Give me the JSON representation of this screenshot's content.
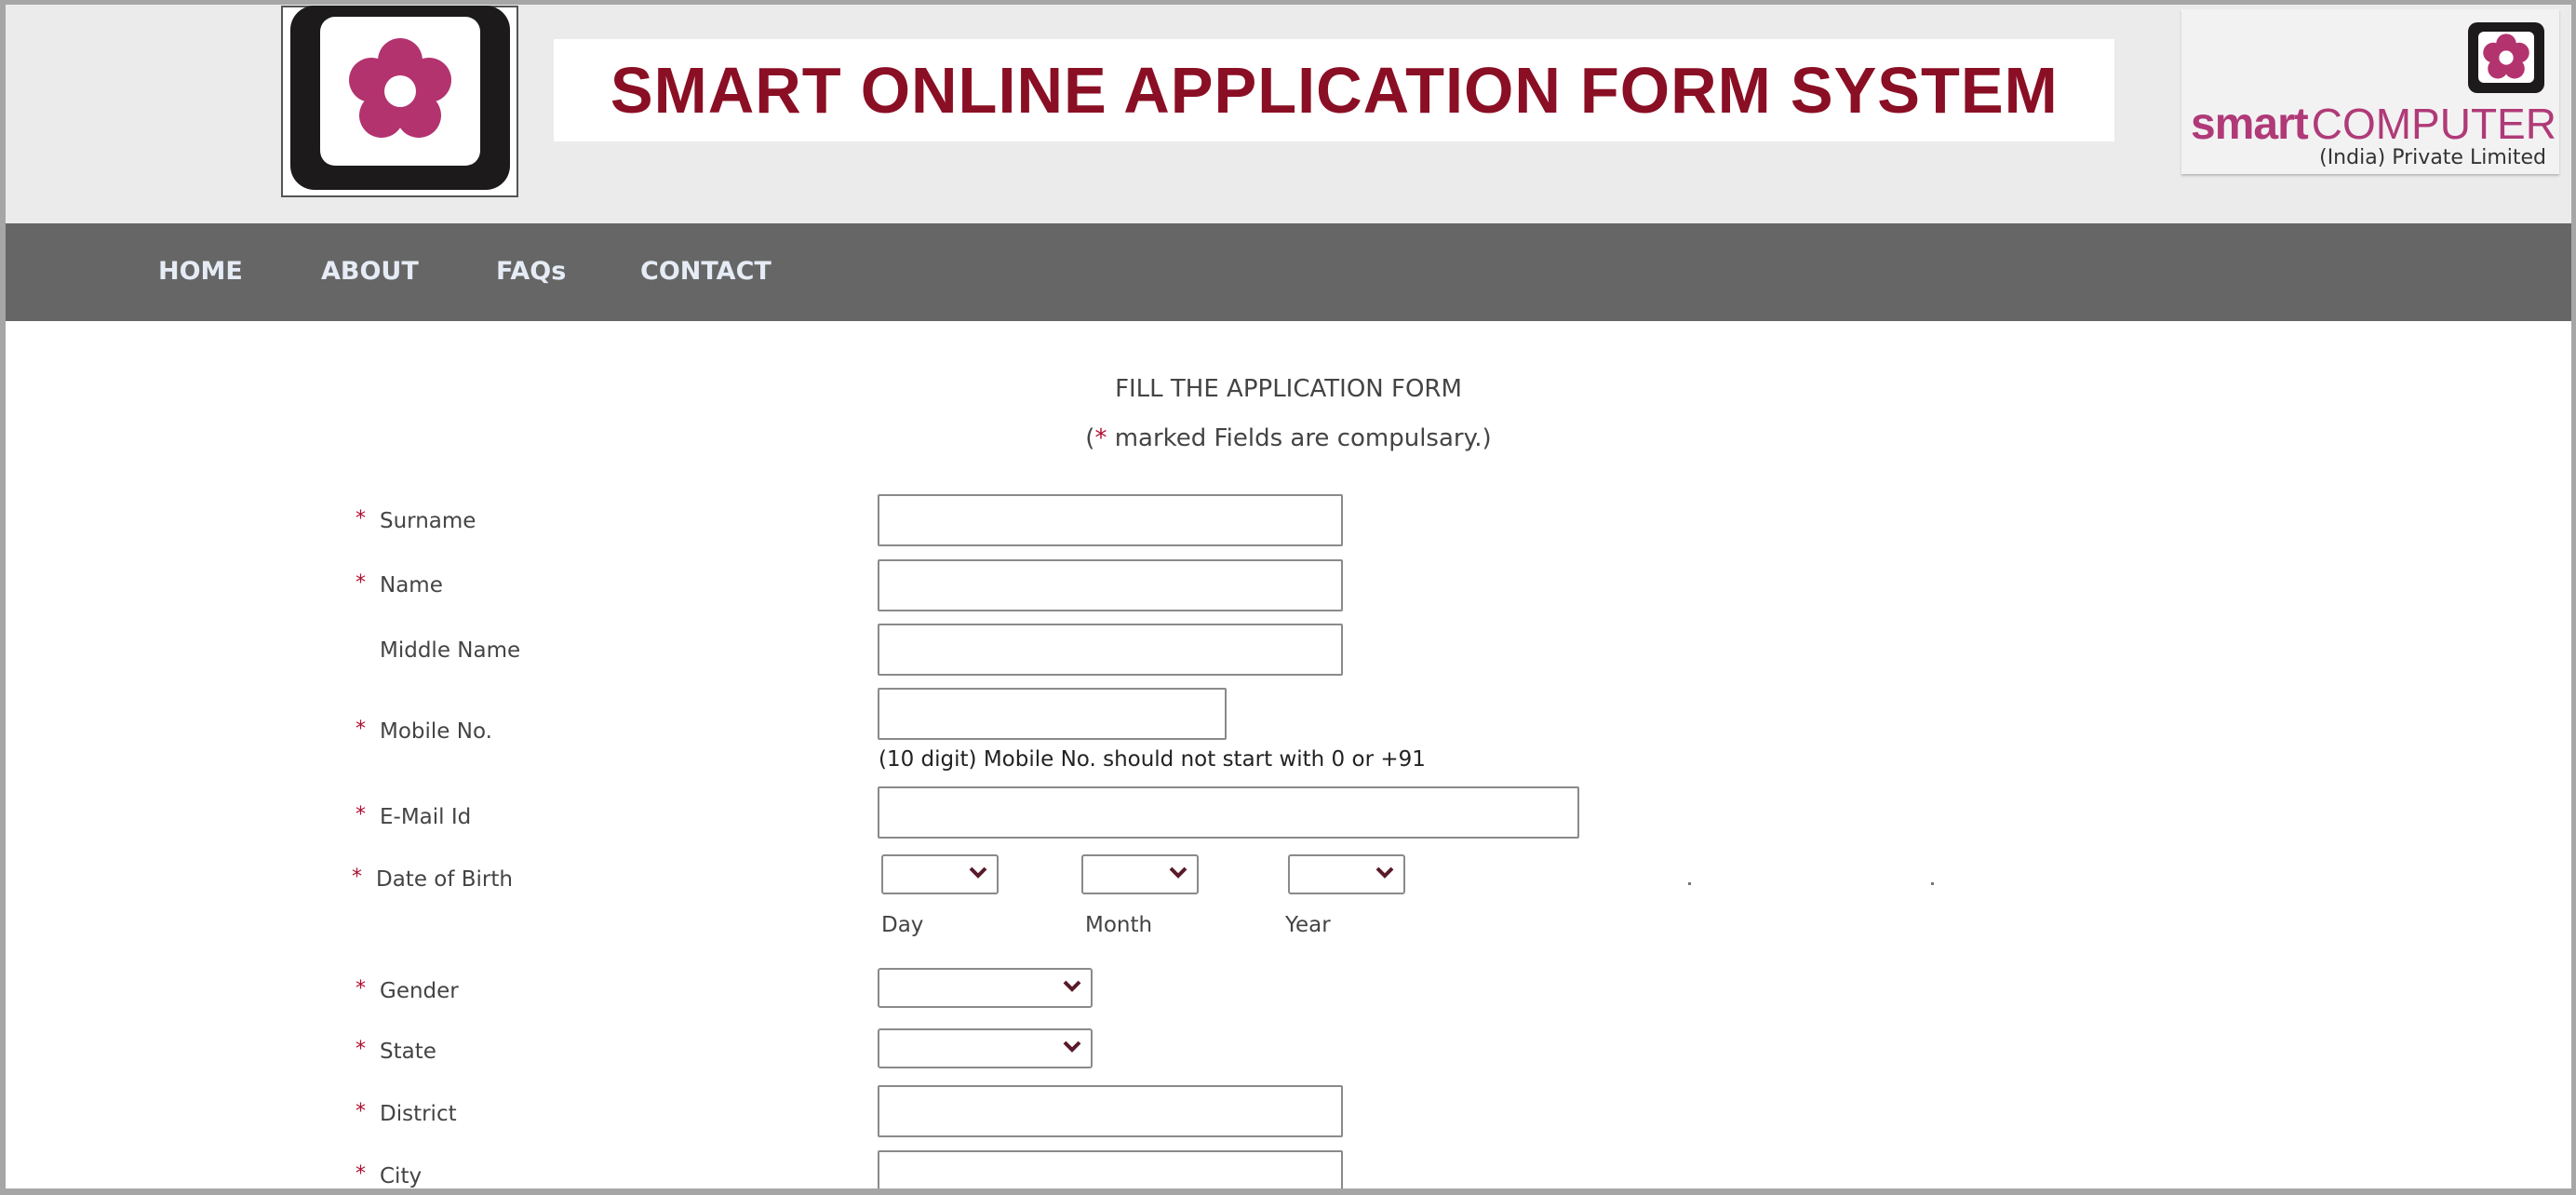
{
  "header": {
    "title": "SMART ONLINE APPLICATION FORM SYSTEM",
    "logo_left_icon": "flower-logo-icon",
    "logo_right": {
      "brand_bold": "smart",
      "brand_light": "COMPUTER",
      "subtitle": "(India) Private Limited"
    },
    "colors": {
      "title": "#8a0f24",
      "brand": "#b03a78",
      "flower": "#b3336f"
    }
  },
  "nav": {
    "items": [
      {
        "label": "HOME"
      },
      {
        "label": "ABOUT"
      },
      {
        "label": "FAQs"
      },
      {
        "label": "CONTACT"
      }
    ]
  },
  "form": {
    "heading": "FILL THE APPLICATION FORM",
    "note_asterisk": "*",
    "note_prefix": "(",
    "note_text": " marked Fields are compulsary.)",
    "required_marker": "*",
    "fields": {
      "surname": {
        "label": "Surname",
        "required": true,
        "value": ""
      },
      "name": {
        "label": "Name",
        "required": true,
        "value": ""
      },
      "middle_name": {
        "label": "Middle Name",
        "required": false,
        "value": ""
      },
      "mobile": {
        "label": "Mobile No.",
        "required": true,
        "value": "",
        "hint": "(10 digit) Mobile No. should not start with 0 or +91"
      },
      "email": {
        "label": "E-Mail Id",
        "required": true,
        "value": ""
      },
      "dob": {
        "label": "Date of Birth",
        "required": true,
        "day_label": "Day",
        "month_label": "Month",
        "year_label": "Year",
        "day_value": "",
        "month_value": "",
        "year_value": ""
      },
      "gender": {
        "label": "Gender",
        "required": true,
        "value": ""
      },
      "state": {
        "label": "State",
        "required": true,
        "value": ""
      },
      "district": {
        "label": "District",
        "required": true,
        "value": ""
      },
      "city": {
        "label": "City",
        "required": true,
        "value": ""
      }
    }
  }
}
